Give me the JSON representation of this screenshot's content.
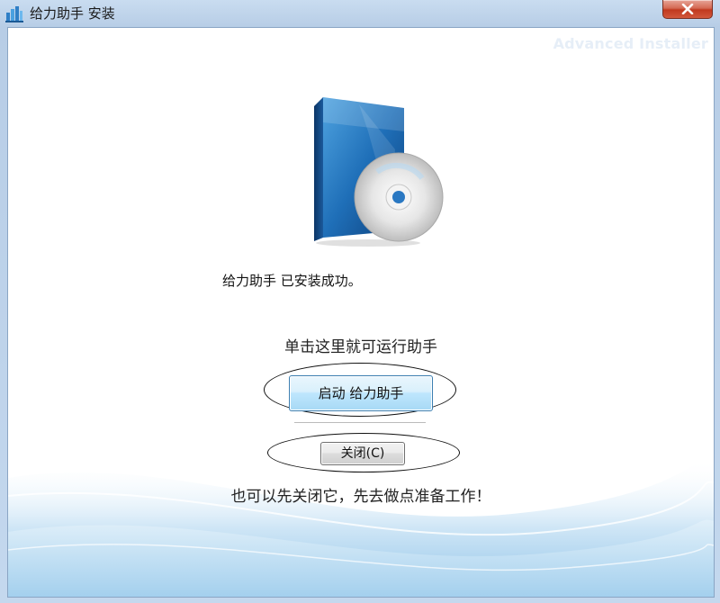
{
  "window": {
    "title": "给力助手 安装",
    "icon": "installer-app-icon",
    "close_icon": "close-x-icon"
  },
  "branding": {
    "text": "Advanced Installer"
  },
  "main": {
    "product_image": "software-box-cd-icon",
    "success_message": "给力助手 已安装成功。",
    "run_hint": "单击这里就可运行助手",
    "launch_button_label": "启动 给力助手",
    "close_button_label": "关闭(C)",
    "footer_message": "也可以先关闭它，先去做点准备工作！"
  },
  "colors": {
    "close_button": "#c0391f",
    "launch_button_border": "#3c7fb1",
    "background_wave": "#8fc3e8"
  }
}
